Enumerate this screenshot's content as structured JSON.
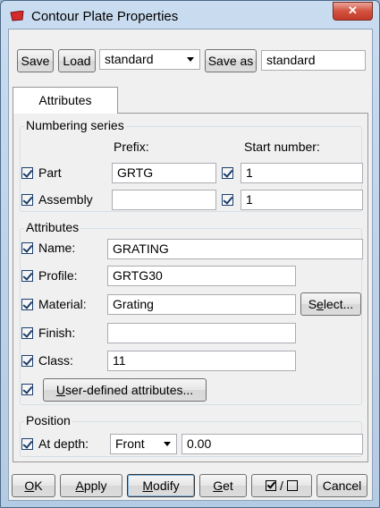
{
  "window": {
    "title": "Contour Plate Properties",
    "close_label": "✕"
  },
  "toolbar": {
    "save_label": "Save",
    "load_label": "Load",
    "load_selected": "standard",
    "save_as_label": "Save as",
    "save_as_value": "standard"
  },
  "tabs": [
    {
      "label": "Attributes"
    }
  ],
  "numbering": {
    "group_label": "Numbering series",
    "prefix_header": "Prefix:",
    "start_header": "Start number:",
    "rows": [
      {
        "label": "Part",
        "prefix": "GRTG",
        "prefix_checked": true,
        "start": "1",
        "start_checked": true
      },
      {
        "label": "Assembly",
        "prefix": "",
        "prefix_checked": true,
        "start": "1",
        "start_checked": true
      }
    ]
  },
  "attributes": {
    "group_label": "Attributes",
    "name": {
      "label": "Name:",
      "value": "GRATING",
      "checked": true
    },
    "profile": {
      "label": "Profile:",
      "value": "GRTG30",
      "checked": true
    },
    "material": {
      "label": "Material:",
      "value": "Grating",
      "checked": true,
      "select_label_pre": "S",
      "select_label_u": "e",
      "select_label_post": "lect..."
    },
    "finish": {
      "label": "Finish:",
      "value": "",
      "checked": true
    },
    "class": {
      "label": "Class:",
      "value": "11",
      "checked": true
    },
    "udf": {
      "label_u": "U",
      "label_post": "ser-defined attributes...",
      "checked": true
    }
  },
  "position": {
    "group_label": "Position",
    "depth_label": "At depth:",
    "depth_option": "Front",
    "depth_value": "0.00",
    "checked": true
  },
  "footer": {
    "ok_u": "O",
    "ok_post": "K",
    "apply_u": "A",
    "apply_post": "pply",
    "modify_u": "M",
    "modify_post": "odify",
    "get_u": "G",
    "get_post": "et",
    "toggle_separator": "/",
    "cancel_label": "Cancel"
  }
}
